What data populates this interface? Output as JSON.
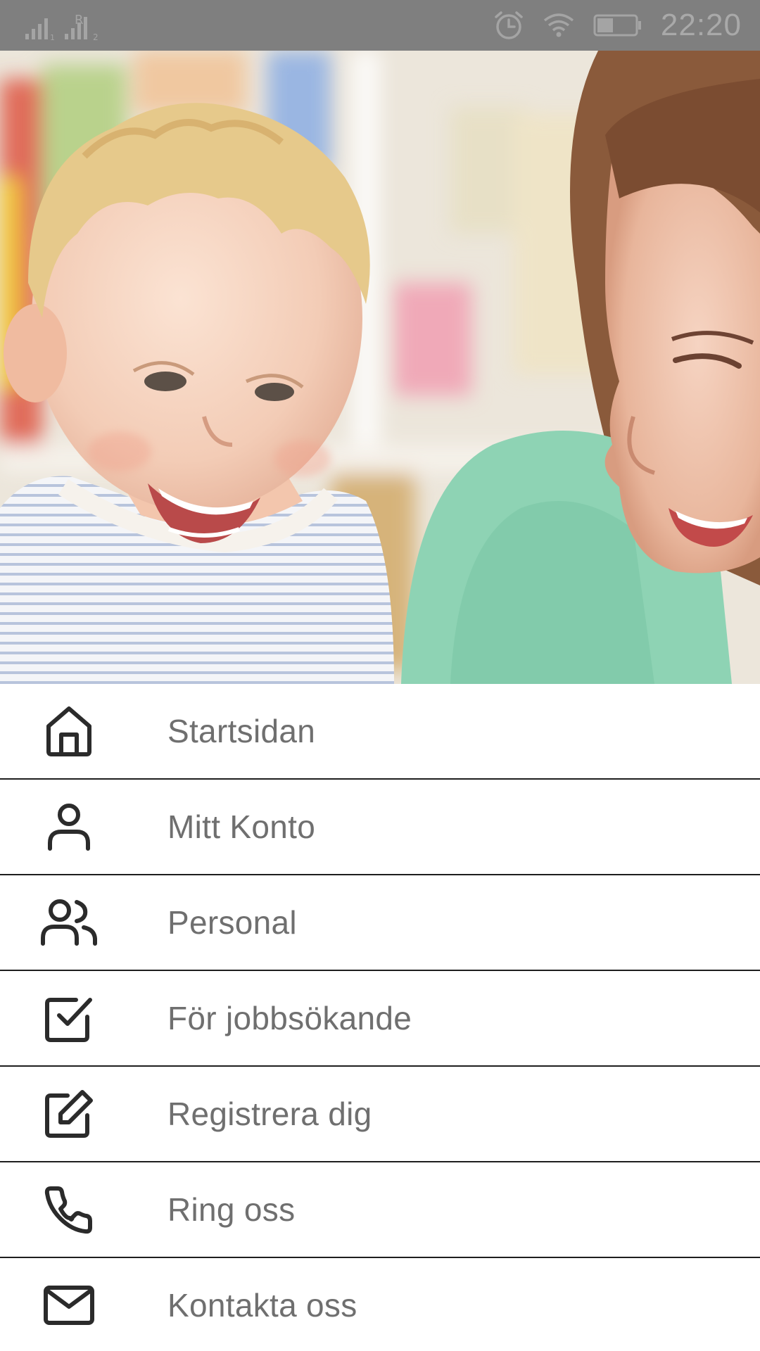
{
  "status_bar": {
    "time": "22:20",
    "sim1_label": "1",
    "sim2_label": "2",
    "roaming_label": "R"
  },
  "hero": {
    "description_icon": "photo"
  },
  "menu": {
    "items": [
      {
        "label": "Startsidan",
        "icon": "home-icon"
      },
      {
        "label": "Mitt Konto",
        "icon": "user-icon"
      },
      {
        "label": "Personal",
        "icon": "users-icon"
      },
      {
        "label": "För jobbsökande",
        "icon": "checkbox-icon"
      },
      {
        "label": "Registrera dig",
        "icon": "edit-icon"
      },
      {
        "label": "Ring oss",
        "icon": "phone-icon"
      },
      {
        "label": "Kontakta oss",
        "icon": "mail-icon"
      }
    ]
  },
  "colors": {
    "status_bar_bg": "#7f7f7f",
    "label_text": "#6f6f6f",
    "icon_stroke": "#2b2b2b",
    "divider": "#1e1e1e"
  }
}
